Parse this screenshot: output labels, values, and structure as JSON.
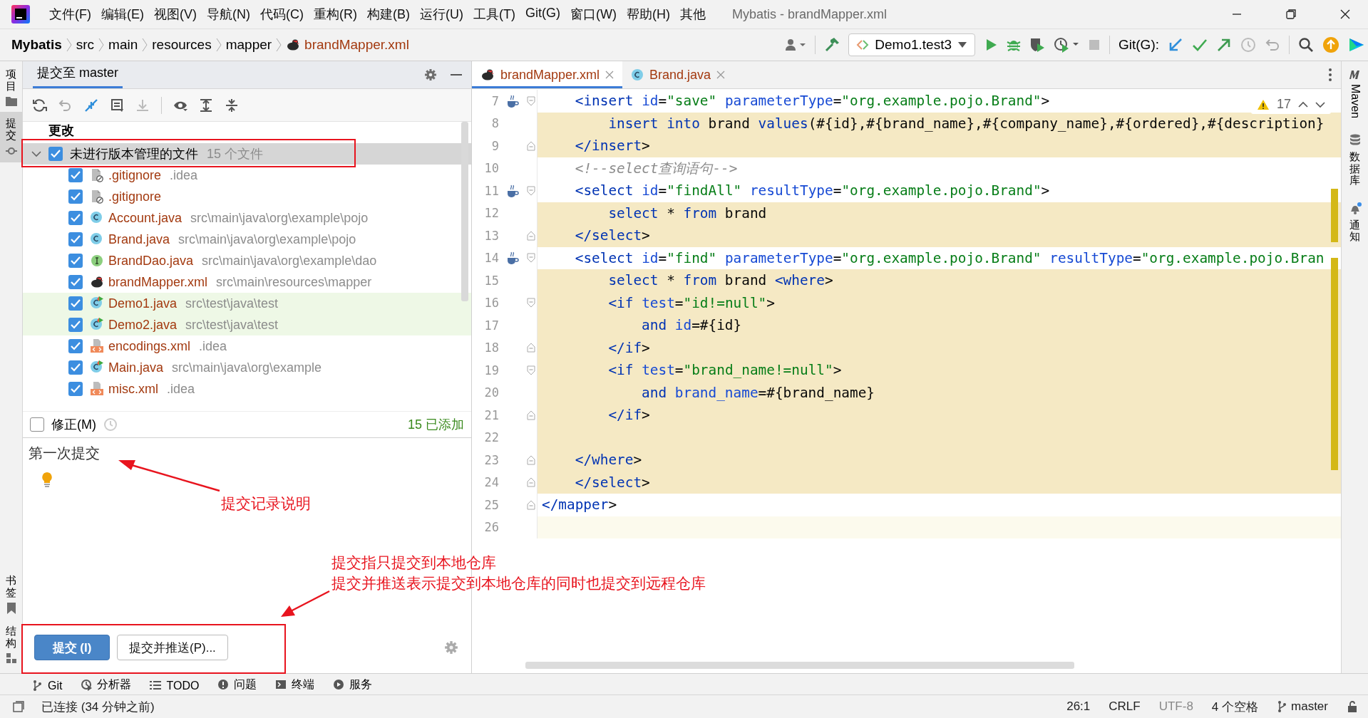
{
  "menu": [
    "文件(F)",
    "编辑(E)",
    "视图(V)",
    "导航(N)",
    "代码(C)",
    "重构(R)",
    "构建(B)",
    "运行(U)",
    "工具(T)",
    "Git(G)",
    "窗口(W)",
    "帮助(H)",
    "其他"
  ],
  "window": {
    "title": "Mybatis - brandMapper.xml"
  },
  "breadcrumbs": [
    {
      "label": "Mybatis",
      "kind": "project"
    },
    {
      "label": "src",
      "kind": "folder"
    },
    {
      "label": "main",
      "kind": "folder"
    },
    {
      "label": "resources",
      "kind": "folder"
    },
    {
      "label": "mapper",
      "kind": "folder"
    },
    {
      "label": "brandMapper.xml",
      "kind": "file"
    }
  ],
  "toolbar": {
    "run_config": "Demo1.test3",
    "git_label": "Git(G):"
  },
  "left_tabs_top": [
    {
      "label": "项目",
      "selected": false
    },
    {
      "label": "提交",
      "selected": true
    }
  ],
  "left_tabs_bottom": [
    {
      "label": "书签",
      "selected": false
    },
    {
      "label": "结构",
      "selected": false
    }
  ],
  "right_tabs": [
    {
      "label": "Maven",
      "kind": "maven"
    },
    {
      "label": "数据库",
      "kind": "database"
    },
    {
      "label": "通知",
      "kind": "bell"
    }
  ],
  "commit_panel": {
    "title": "提交至 master",
    "section": "更改",
    "group": {
      "label": "未进行版本管理的文件",
      "count": "15 个文件",
      "checked": true,
      "expanded": true
    },
    "files": [
      {
        "name": ".gitignore",
        "path": ".idea",
        "kind": "ignored",
        "checked": true,
        "test_scope": false
      },
      {
        "name": ".gitignore",
        "kind": "ignored",
        "checked": true,
        "test_scope": false
      },
      {
        "name": "Account.java",
        "path": "src\\main\\java\\org\\example\\pojo",
        "kind": "class",
        "checked": true,
        "test_scope": false
      },
      {
        "name": "Brand.java",
        "path": "src\\main\\java\\org\\example\\pojo",
        "kind": "class",
        "checked": true,
        "test_scope": false
      },
      {
        "name": "BrandDao.java",
        "path": "src\\main\\java\\org\\example\\dao",
        "kind": "interface",
        "checked": true,
        "test_scope": false
      },
      {
        "name": "brandMapper.xml",
        "path": "src\\main\\resources\\mapper",
        "kind": "mybatis",
        "checked": true,
        "test_scope": false
      },
      {
        "name": "Demo1.java",
        "path": "src\\test\\java\\test",
        "kind": "runnable",
        "checked": true,
        "test_scope": true
      },
      {
        "name": "Demo2.java",
        "path": "src\\test\\java\\test",
        "kind": "runnable",
        "checked": true,
        "test_scope": true
      },
      {
        "name": "encodings.xml",
        "path": ".idea",
        "kind": "xml",
        "checked": true,
        "test_scope": false
      },
      {
        "name": "Main.java",
        "path": "src\\main\\java\\org\\example",
        "kind": "runnable",
        "checked": true,
        "test_scope": false
      },
      {
        "name": "misc.xml",
        "path": ".idea",
        "kind": "xml",
        "checked": true,
        "test_scope": false
      }
    ],
    "amend": {
      "label": "修正(M)",
      "checked": false
    },
    "added": "15 已添加",
    "message": "第一次提交",
    "commit_button": "提交 (I)",
    "commit_push_button": "提交并推送(P)..."
  },
  "editor": {
    "tabs": [
      {
        "label": "brandMapper.xml",
        "kind": "mybatis",
        "selected": true
      },
      {
        "label": "Brand.java",
        "kind": "class",
        "selected": false
      }
    ],
    "warnings": "17",
    "lines": [
      {
        "num": "7",
        "bean": true,
        "fold_start": true,
        "fold_end": false,
        "injected": false,
        "current": false,
        "text": "    <insert id=\"save\" parameterType=\"org.example.pojo.Brand\">"
      },
      {
        "num": "8",
        "bean": false,
        "fold_start": false,
        "fold_end": false,
        "injected": true,
        "current": false,
        "text": "        insert into brand values(#{id},#{brand_name},#{company_name},#{ordered},#{description}"
      },
      {
        "num": "9",
        "bean": false,
        "fold_start": false,
        "fold_end": true,
        "injected": true,
        "current": false,
        "text": "    </insert>"
      },
      {
        "num": "10",
        "bean": false,
        "fold_start": false,
        "fold_end": false,
        "injected": false,
        "current": false,
        "text": "    <!--select查询语句-->"
      },
      {
        "num": "11",
        "bean": true,
        "fold_start": true,
        "fold_end": false,
        "injected": false,
        "current": false,
        "text": "    <select id=\"findAll\" resultType=\"org.example.pojo.Brand\">"
      },
      {
        "num": "12",
        "bean": false,
        "fold_start": false,
        "fold_end": false,
        "injected": true,
        "current": false,
        "text": "        select * from brand"
      },
      {
        "num": "13",
        "bean": false,
        "fold_start": false,
        "fold_end": true,
        "injected": true,
        "current": false,
        "text": "    </select>"
      },
      {
        "num": "14",
        "bean": true,
        "fold_start": true,
        "fold_end": false,
        "injected": false,
        "current": false,
        "text": "    <select id=\"find\" parameterType=\"org.example.pojo.Brand\" resultType=\"org.example.pojo.Bran"
      },
      {
        "num": "15",
        "bean": false,
        "fold_start": false,
        "fold_end": false,
        "injected": true,
        "current": false,
        "text": "        select * from brand <where>"
      },
      {
        "num": "16",
        "bean": false,
        "fold_start": true,
        "fold_end": false,
        "injected": true,
        "current": false,
        "text": "        <if test=\"id!=null\">"
      },
      {
        "num": "17",
        "bean": false,
        "fold_start": false,
        "fold_end": false,
        "injected": true,
        "current": false,
        "text": "            and id=#{id}"
      },
      {
        "num": "18",
        "bean": false,
        "fold_start": false,
        "fold_end": true,
        "injected": true,
        "current": false,
        "text": "        </if>"
      },
      {
        "num": "19",
        "bean": false,
        "fold_start": true,
        "fold_end": false,
        "injected": true,
        "current": false,
        "text": "        <if test=\"brand_name!=null\">"
      },
      {
        "num": "20",
        "bean": false,
        "fold_start": false,
        "fold_end": false,
        "injected": true,
        "current": false,
        "text": "            and brand_name=#{brand_name}"
      },
      {
        "num": "21",
        "bean": false,
        "fold_start": false,
        "fold_end": true,
        "injected": true,
        "current": false,
        "text": "        </if>"
      },
      {
        "num": "22",
        "bean": false,
        "fold_start": false,
        "fold_end": false,
        "injected": true,
        "current": false
      },
      {
        "num": "23",
        "bean": false,
        "fold_start": false,
        "fold_end": true,
        "injected": true,
        "current": false,
        "text": "    </where>"
      },
      {
        "num": "24",
        "bean": false,
        "fold_start": false,
        "fold_end": true,
        "injected": true,
        "current": false,
        "text": "    </select>"
      },
      {
        "num": "25",
        "bean": false,
        "fold_start": false,
        "fold_end": true,
        "injected": false,
        "current": false,
        "text": "</mapper>"
      },
      {
        "num": "26",
        "bean": false,
        "fold_start": false,
        "fold_end": false,
        "injected": false,
        "current": true
      }
    ]
  },
  "tool_windows": [
    {
      "label": "Git",
      "kind": "branch"
    },
    {
      "label": "分析器",
      "kind": "profiler"
    },
    {
      "label": "TODO",
      "kind": "list"
    },
    {
      "label": "问题",
      "kind": "problem"
    },
    {
      "label": "终端",
      "kind": "terminal"
    },
    {
      "label": "服务",
      "kind": "services"
    }
  ],
  "status_bar": {
    "message": "已连接 (34 分钟之前)",
    "position": "26:1",
    "line_endings": "CRLF",
    "encoding": "UTF-8",
    "indent": "4 个空格",
    "branch": "master"
  },
  "annotations": [
    {
      "text": "提交记录说明"
    },
    {
      "text": "提交指只提交到本地仓库"
    },
    {
      "text": "提交并推送表示提交到本地仓库的同时也提交到远程仓库"
    }
  ]
}
